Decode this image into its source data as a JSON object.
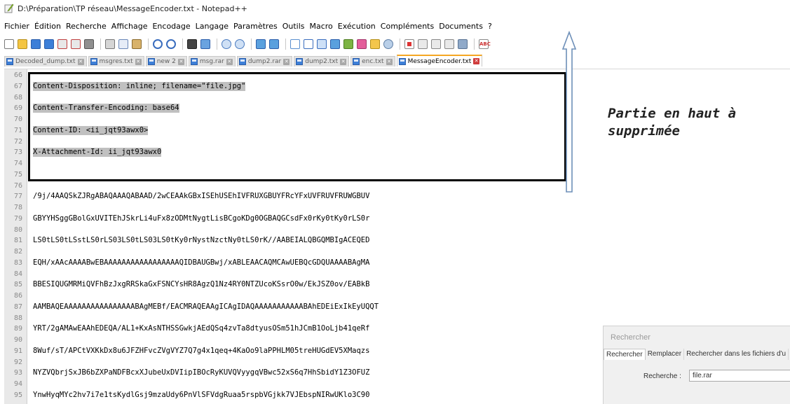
{
  "window": {
    "title": "D:\\Préparation\\TP réseau\\MessageEncoder.txt - Notepad++"
  },
  "menu": [
    "Fichier",
    "Édition",
    "Recherche",
    "Affichage",
    "Encodage",
    "Langage",
    "Paramètres",
    "Outils",
    "Macro",
    "Exécution",
    "Compléments",
    "Documents",
    "?"
  ],
  "toolbar_icons": [
    "new-file-icon",
    "open-file-icon",
    "save-icon",
    "save-all-icon",
    "close-icon",
    "close-all-icon",
    "print-icon",
    "cut-icon",
    "copy-icon",
    "paste-icon",
    "undo-icon",
    "redo-icon",
    "find-icon",
    "replace-icon",
    "zoom-in-icon",
    "zoom-out-icon",
    "sync-vertical-icon",
    "sync-horizontal-icon",
    "word-wrap-icon",
    "show-all-chars-icon",
    "indent-guide-icon",
    "doc-map-icon",
    "function-list-icon",
    "folder-workspace-icon",
    "monitoring-icon",
    "record-macro-icon",
    "stop-record-icon",
    "play-macro-icon",
    "run-macro-multiple-icon",
    "save-macro-icon",
    "spellcheck-icon"
  ],
  "tabs": [
    {
      "label": "Decoded_dump.txt",
      "active": false
    },
    {
      "label": "msgres.txt",
      "active": false
    },
    {
      "label": "new 2",
      "active": false
    },
    {
      "label": "msg.rar",
      "active": false
    },
    {
      "label": "dump2.rar",
      "active": false
    },
    {
      "label": "dump2.txt",
      "active": false
    },
    {
      "label": "enc.txt",
      "active": false
    },
    {
      "label": "MessageEncoder.txt",
      "active": true
    }
  ],
  "lines": [
    {
      "n": "66",
      "t": "",
      "hl": false
    },
    {
      "n": "67",
      "t": "Content-Disposition: inline; filename=\"file.jpg\"",
      "hl": true
    },
    {
      "n": "68",
      "t": "",
      "hl": false
    },
    {
      "n": "69",
      "t": "Content-Transfer-Encoding: base64",
      "hl": true
    },
    {
      "n": "70",
      "t": "",
      "hl": false
    },
    {
      "n": "71",
      "t": "Content-ID: <ii_jqt93awx0>",
      "hl": true
    },
    {
      "n": "72",
      "t": "",
      "hl": false
    },
    {
      "n": "73",
      "t": "X-Attachment-Id: ii_jqt93awx0",
      "hl": true
    },
    {
      "n": "74",
      "t": "",
      "hl": false
    },
    {
      "n": "75",
      "t": "",
      "hl": false
    },
    {
      "n": "76",
      "t": "",
      "hl": false
    },
    {
      "n": "77",
      "t": "/9j/4AAQSkZJRgABAQAAAQABAAD/2wCEAAkGBxISEhUSEhIVFRUXGBUYFRcYFxUVFRUVFRUWGBUV",
      "hl": false
    },
    {
      "n": "78",
      "t": "",
      "hl": false
    },
    {
      "n": "79",
      "t": "GBYYHSggGBolGxUVITEhJSkrLi4uFx8zODMtNygtLisBCgoKDg0OGBAQGCsdFx0rKy0tKy0rLS0r",
      "hl": false
    },
    {
      "n": "80",
      "t": "",
      "hl": false
    },
    {
      "n": "81",
      "t": "LS0tLS0tLSstLS0rLS03LS0tLS03LS0tKy0rNystNzctNy0tLS0rK//AABEIALQBGQMBIgACEQED",
      "hl": false
    },
    {
      "n": "82",
      "t": "",
      "hl": false
    },
    {
      "n": "83",
      "t": "EQH/xAAcAAAABwEBAAAAAAAAAAAAAAAAAQIDBAUGBwj/xABLEAACAQMCAwUEBQcGDQUAAAABAgMA",
      "hl": false
    },
    {
      "n": "84",
      "t": "",
      "hl": false
    },
    {
      "n": "85",
      "t": "BBESIQUGMRMiQVFhBzJxgRRSkaGxFSNCYsHR8AgzQ1Nz4RY0NTZUcoKSsrO0w/EkJSZ0ov/EABkB",
      "hl": false
    },
    {
      "n": "86",
      "t": "",
      "hl": false
    },
    {
      "n": "87",
      "t": "AAMBAQEAAAAAAAAAAAAAAAABAgMEBf/EACMRAQEAAgICAgIDAQAAAAAAAAAAABAhEDEiExIkEyUQQT",
      "hl": false
    },
    {
      "n": "88",
      "t": "",
      "hl": false
    },
    {
      "n": "89",
      "t": "YRT/2gAMAwEAAhEDEQA/AL1+KxAsNTHSSGwkjAEdQSq4zvTa8dtyusOSm51hJCmB1OoLjb41qeRf",
      "hl": false
    },
    {
      "n": "90",
      "t": "",
      "hl": false
    },
    {
      "n": "91",
      "t": "8Wuf/sT/APCtVXKkDx8u6JFZHFvcZVgVYZ7Q7g4x1qeq+4KaOo9laPPHLM05treHUGdEV5XMaqzs",
      "hl": false
    },
    {
      "n": "92",
      "t": "",
      "hl": false
    },
    {
      "n": "93",
      "t": "NYZVQbrjSxJB6bZXPaNDFBcxXJubeUxDVIipIBOcRyKUVQVyygqVBwc52xS6q7HhSbidY1Z3OFUZ",
      "hl": false
    },
    {
      "n": "94",
      "t": "",
      "hl": false
    },
    {
      "n": "95",
      "t": "YnwHyqMYc2hv7i7e1tsKydlGsj9mzaUdy6PnVlSFVdgRuaa5rspbVGjkk7VJEbspNIRwUKlo3C90",
      "hl": false
    }
  ],
  "annotation": {
    "line1": "Partie en haut à",
    "line2": "supprimée"
  },
  "find_dialog": {
    "title": "Rechercher",
    "tabs": [
      "Rechercher",
      "Remplacer",
      "Rechercher dans les fichiers d'u"
    ],
    "label": "Recherche :",
    "value": "file.rar"
  }
}
